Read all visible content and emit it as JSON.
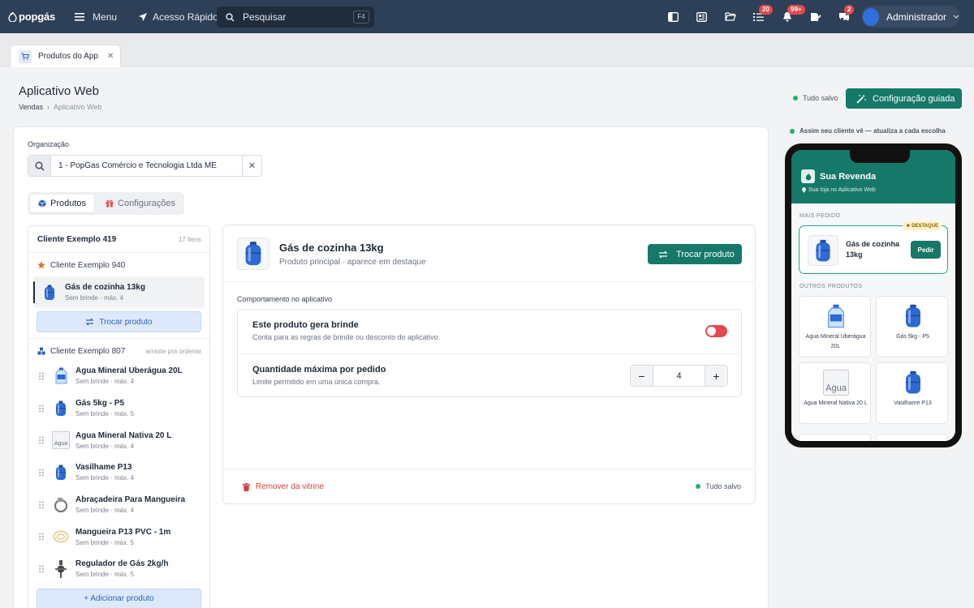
{
  "topbar": {
    "logo_text": "popgás",
    "menu_label": "Menu",
    "quick_access_label": "Acesso Rápido",
    "search_placeholder": "Pesquisar",
    "search_shortcut": "F4",
    "icons": [
      {
        "name": "panel-icon",
        "badge": null
      },
      {
        "name": "newspaper-icon",
        "badge": null
      },
      {
        "name": "folder-open-icon",
        "badge": null
      },
      {
        "name": "tasks-icon",
        "badge": "20"
      },
      {
        "name": "bell-icon",
        "badge": "99+"
      },
      {
        "name": "signature-icon",
        "badge": null
      },
      {
        "name": "chat-icon",
        "badge": "2"
      }
    ],
    "user_name": "Administrador"
  },
  "tabs": [
    {
      "label": "Produtos do App",
      "icon": "cart-icon"
    }
  ],
  "page": {
    "title": "Aplicativo Web",
    "breadcrumb": [
      "Vendas",
      "Aplicativo Web"
    ],
    "saved_status": "Tudo salvo",
    "guided_button": "Configuração guiada"
  },
  "org": {
    "label": "Organização",
    "value": "1 - PopGas Comércio e Tecnologia Ltda ME"
  },
  "segments": [
    {
      "label": "Produtos",
      "active": true
    },
    {
      "label": "Configurações",
      "active": false
    }
  ],
  "list": {
    "header_title": "Cliente Exemplo 419",
    "header_count": "17 itens",
    "featured_group": "Cliente Exemplo 940",
    "selected_item": {
      "name": "Gás de cozinha 13kg",
      "sub": "Sem brinde · máx. 4"
    },
    "swap_button": "Trocar produto",
    "other_group": "Cliente Exemplo 807",
    "other_hint": "arraste pra ordenar",
    "items": [
      {
        "name": "Agua Mineral Uberágua 20L",
        "sub": "Sem brinde · máx. 4",
        "thumb": "water"
      },
      {
        "name": "Gás 5kg - P5",
        "sub": "Sem brinde · máx. 5",
        "thumb": "gas"
      },
      {
        "name": "Agua Mineral Nativa 20 L",
        "sub": "Sem brinde · máx. 4",
        "thumb": "broken",
        "alt": "Agua"
      },
      {
        "name": "Vasilhame P13",
        "sub": "Sem brinde · máx. 4",
        "thumb": "gas"
      },
      {
        "name": "Abraçadeira Para Mangueira",
        "sub": "Sem brinde · máx. 4",
        "thumb": "clamp"
      },
      {
        "name": "Mangueira P13 PVC - 1m",
        "sub": "Sem brinde · máx. 5",
        "thumb": "hose"
      },
      {
        "name": "Regulador de Gás 2kg/h",
        "sub": "Sem brinde · máx. 5",
        "thumb": "regulator"
      }
    ],
    "add_button": "+ Adicionar produto"
  },
  "detail": {
    "title": "Gás de cozinha 13kg",
    "subtitle": "Produto principal · aparece em destaque",
    "swap_button": "Trocar produto",
    "behavior_label": "Comportamento no aplicativo",
    "gift_title": "Este produto gera brinde",
    "gift_desc": "Conta para as regras de brinde ou desconto do aplicativo.",
    "gift_enabled": false,
    "qty_title": "Quantidade máxima por pedido",
    "qty_desc": "Limite permitido em uma única compra.",
    "qty_value": "4",
    "remove_button": "Remover da vitrine",
    "saved_status": "Tudo salvo"
  },
  "preview": {
    "note": "Assim seu cliente vê — atualiza a cada escolha",
    "store_title": "Sua Revenda",
    "store_sub": "Sua loja no Aplicativo Web",
    "section_featured": "MAIS PEDIDO",
    "featured_badge": "★ DESTAQUE",
    "featured_name": "Gás de cozinha 13kg",
    "order_button": "Pedir",
    "section_others": "OUTROS PRODUTOS",
    "products": [
      {
        "name": "Agua Mineral Uberágua 20L",
        "thumb": "water"
      },
      {
        "name": "Gás 5kg - P5",
        "thumb": "gas"
      },
      {
        "name": "Agua Mineral Nativa 20 L",
        "thumb": "broken",
        "alt": "Agua"
      },
      {
        "name": "Vasilhame P13",
        "thumb": "gas"
      }
    ]
  },
  "colors": {
    "topbar": "#2e4057",
    "primary": "#167868",
    "danger": "#e5484d",
    "success": "#25b16d"
  }
}
